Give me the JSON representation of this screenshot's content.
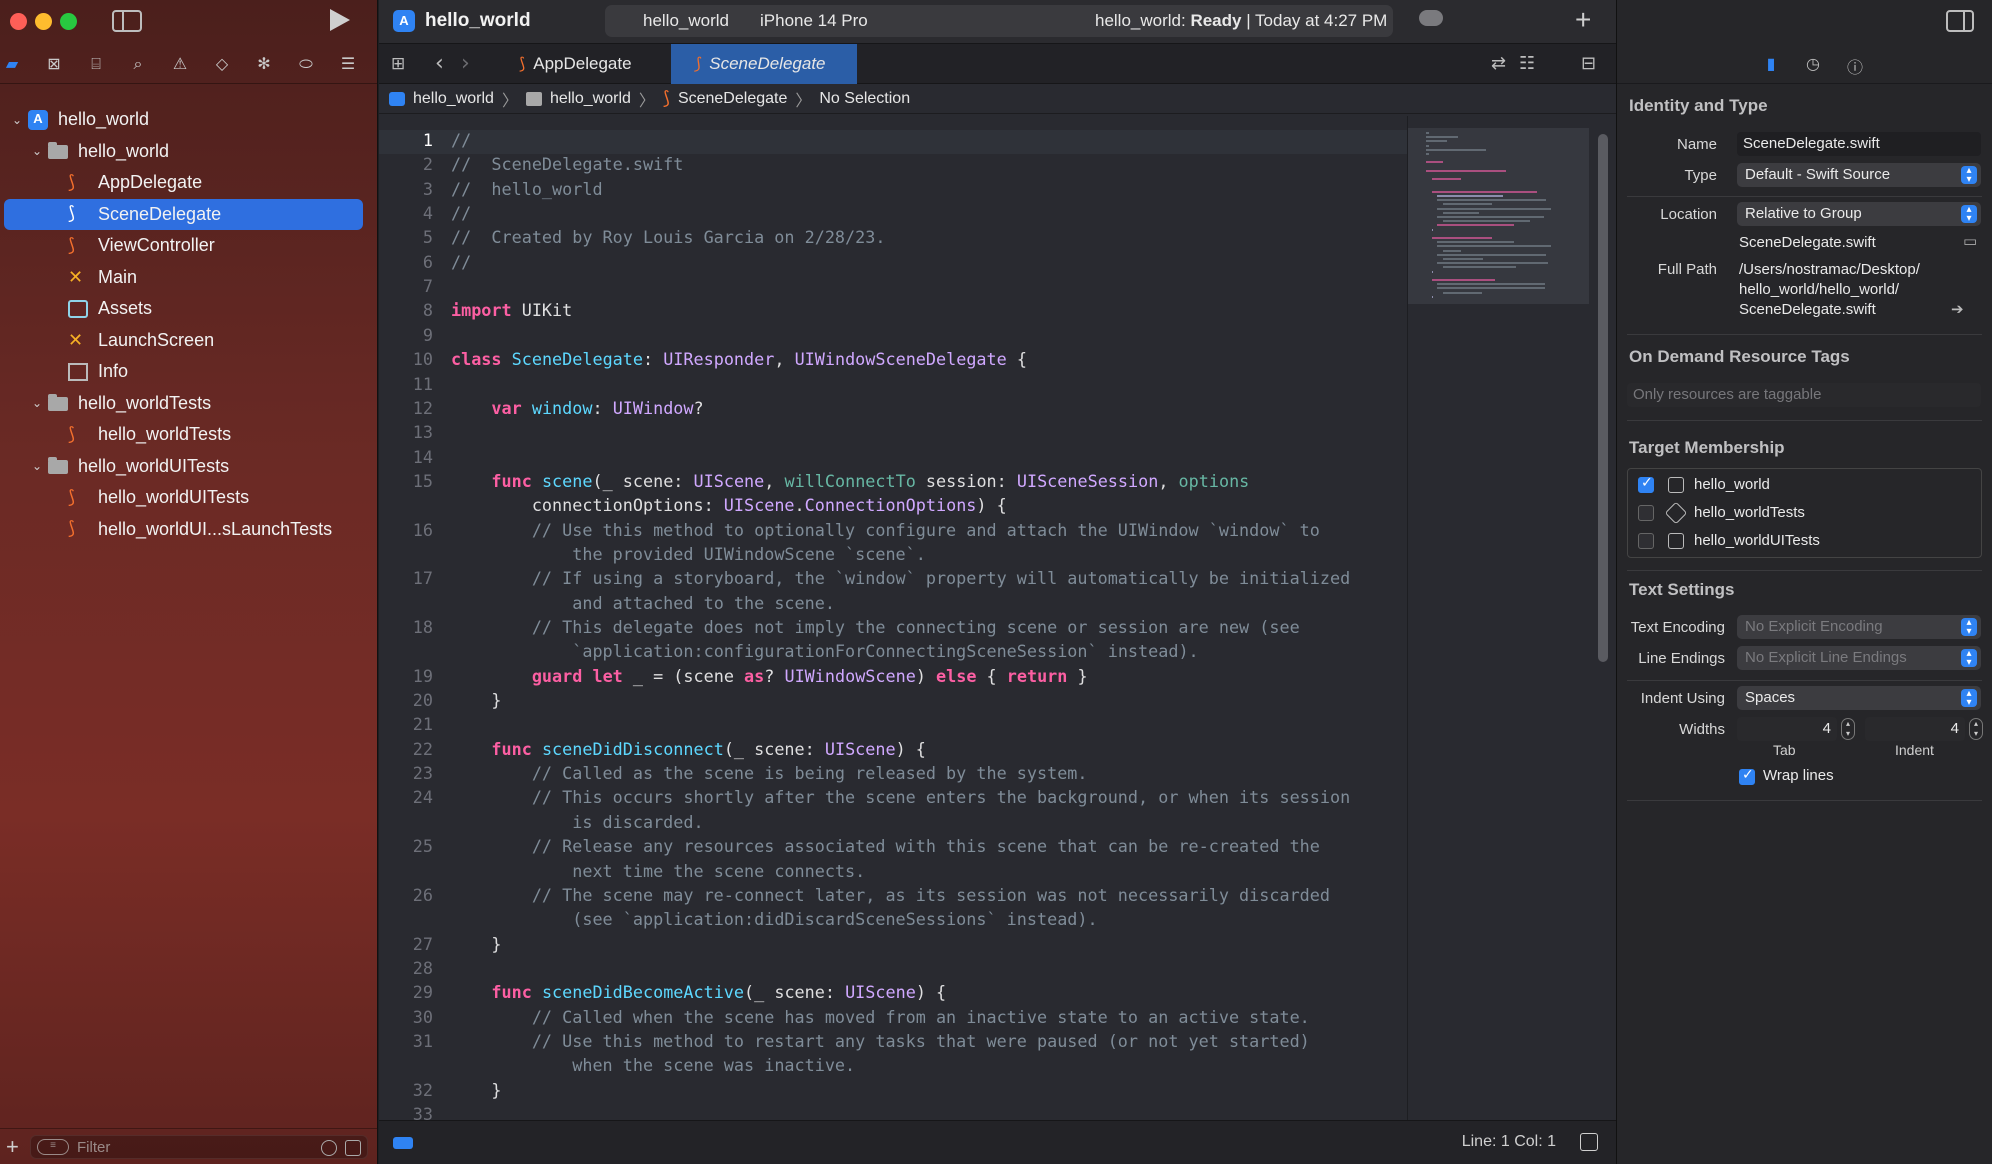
{
  "navigator": {
    "tree": [
      {
        "label": "hello_world",
        "level": 0,
        "icon": "project-icon",
        "expanded": true
      },
      {
        "label": "hello_world",
        "level": 1,
        "icon": "folder-icon",
        "expanded": true
      },
      {
        "label": "AppDelegate",
        "level": 2,
        "icon": "swift-file-icon"
      },
      {
        "label": "SceneDelegate",
        "level": 2,
        "icon": "swift-file-icon",
        "selected": true
      },
      {
        "label": "ViewController",
        "level": 2,
        "icon": "swift-file-icon"
      },
      {
        "label": "Main",
        "level": 2,
        "icon": "storyboard-icon"
      },
      {
        "label": "Assets",
        "level": 2,
        "icon": "asset-catalog-icon"
      },
      {
        "label": "LaunchScreen",
        "level": 2,
        "icon": "storyboard-icon"
      },
      {
        "label": "Info",
        "level": 2,
        "icon": "plist-icon"
      },
      {
        "label": "hello_worldTests",
        "level": 1,
        "icon": "folder-icon",
        "expanded": true
      },
      {
        "label": "hello_worldTests",
        "level": 2,
        "icon": "swift-file-icon"
      },
      {
        "label": "hello_worldUITests",
        "level": 1,
        "icon": "folder-icon",
        "expanded": true
      },
      {
        "label": "hello_worldUITests",
        "level": 2,
        "icon": "swift-file-icon"
      },
      {
        "label": "hello_worldUI...sLaunchTests",
        "level": 2,
        "icon": "swift-file-icon"
      }
    ],
    "filter_placeholder": "Filter"
  },
  "toolbar": {
    "project_title": "hello_world",
    "scheme": "hello_world",
    "device": "iPhone 14 Pro",
    "status_prefix": "hello_world: ",
    "status_state": "Ready",
    "status_suffix": " | Today at 4:27 PM"
  },
  "tabs": [
    {
      "label": "AppDelegate",
      "active": false
    },
    {
      "label": "SceneDelegate",
      "active": true
    }
  ],
  "jumpbar": [
    "hello_world",
    "hello_world",
    "SceneDelegate",
    "No Selection"
  ],
  "code": {
    "current_line": 1,
    "lines": [
      {
        "n": "1",
        "html": "<span class='cmt'>//</span>"
      },
      {
        "n": "2",
        "html": "<span class='cmt'>//  SceneDelegate.swift</span>"
      },
      {
        "n": "3",
        "html": "<span class='cmt'>//  hello_world</span>"
      },
      {
        "n": "4",
        "html": "<span class='cmt'>//</span>"
      },
      {
        "n": "5",
        "html": "<span class='cmt'>//  Created by Roy Louis Garcia on 2/28/23.</span>"
      },
      {
        "n": "6",
        "html": "<span class='cmt'>//</span>"
      },
      {
        "n": "7",
        "html": ""
      },
      {
        "n": "8",
        "html": "<span class='kw'>import</span> UIKit"
      },
      {
        "n": "9",
        "html": ""
      },
      {
        "n": "10",
        "html": "<span class='kw'>class</span> <span class='cls'>SceneDelegate</span>: <span class='ty'>UIResponder</span>, <span class='ty'>UIWindowSceneDelegate</span> {"
      },
      {
        "n": "11",
        "html": ""
      },
      {
        "n": "12",
        "html": "    <span class='kw'>var</span> <span class='cls'>window</span>: <span class='ty'>UIWindow</span>?"
      },
      {
        "n": "13",
        "html": ""
      },
      {
        "n": "14",
        "html": ""
      },
      {
        "n": "15",
        "html": "    <span class='kw'>func</span> <span class='cls'>scene</span>(_ scene: <span class='ty'>UIScene</span>, <span class='fn'>willConnectTo</span> session: <span class='ty'>UISceneSession</span>, <span class='fn'>options</span>"
      },
      {
        "n": "",
        "html": "        connectionOptions: <span class='ty'>UIScene</span>.<span class='ty'>ConnectionOptions</span>) {"
      },
      {
        "n": "16",
        "html": "        <span class='cmt'>// Use this method to optionally configure and attach the UIWindow `window` to</span>"
      },
      {
        "n": "",
        "html": "            <span class='cmt'>the provided UIWindowScene `scene`.</span>"
      },
      {
        "n": "17",
        "html": "        <span class='cmt'>// If using a storyboard, the `window` property will automatically be initialized</span>"
      },
      {
        "n": "",
        "html": "            <span class='cmt'>and attached to the scene.</span>"
      },
      {
        "n": "18",
        "html": "        <span class='cmt'>// This delegate does not imply the connecting scene or session are new (see</span>"
      },
      {
        "n": "",
        "html": "            <span class='cmt'>`application:configurationForConnectingSceneSession` instead).</span>"
      },
      {
        "n": "19",
        "html": "        <span class='kw'>guard</span> <span class='kw'>let</span> _ = (scene <span class='kw'>as</span>? <span class='ty'>UIWindowScene</span>) <span class='kw'>else</span> { <span class='kw'>return</span> }"
      },
      {
        "n": "20",
        "html": "    }"
      },
      {
        "n": "21",
        "html": ""
      },
      {
        "n": "22",
        "html": "    <span class='kw'>func</span> <span class='cls'>sceneDidDisconnect</span>(_ scene: <span class='ty'>UIScene</span>) {"
      },
      {
        "n": "23",
        "html": "        <span class='cmt'>// Called as the scene is being released by the system.</span>"
      },
      {
        "n": "24",
        "html": "        <span class='cmt'>// This occurs shortly after the scene enters the background, or when its session</span>"
      },
      {
        "n": "",
        "html": "            <span class='cmt'>is discarded.</span>"
      },
      {
        "n": "25",
        "html": "        <span class='cmt'>// Release any resources associated with this scene that can be re-created the</span>"
      },
      {
        "n": "",
        "html": "            <span class='cmt'>next time the scene connects.</span>"
      },
      {
        "n": "26",
        "html": "        <span class='cmt'>// The scene may re-connect later, as its session was not necessarily discarded</span>"
      },
      {
        "n": "",
        "html": "            <span class='cmt'>(see `application:didDiscardSceneSessions` instead).</span>"
      },
      {
        "n": "27",
        "html": "    }"
      },
      {
        "n": "28",
        "html": ""
      },
      {
        "n": "29",
        "html": "    <span class='kw'>func</span> <span class='cls'>sceneDidBecomeActive</span>(_ scene: <span class='ty'>UIScene</span>) {"
      },
      {
        "n": "30",
        "html": "        <span class='cmt'>// Called when the scene has moved from an inactive state to an active state.</span>"
      },
      {
        "n": "31",
        "html": "        <span class='cmt'>// Use this method to restart any tasks that were paused (or not yet started)</span>"
      },
      {
        "n": "",
        "html": "            <span class='cmt'>when the scene was inactive.</span>"
      },
      {
        "n": "32",
        "html": "    }"
      },
      {
        "n": "33",
        "html": ""
      }
    ]
  },
  "statusbar": {
    "position": "Line: 1  Col: 1"
  },
  "inspector": {
    "identity_title": "Identity and Type",
    "name_label": "Name",
    "name_value": "SceneDelegate.swift",
    "type_label": "Type",
    "type_value": "Default - Swift Source",
    "location_label": "Location",
    "location_value": "Relative to Group",
    "location_file": "SceneDelegate.swift",
    "fullpath_label": "Full Path",
    "fullpath_1": "/Users/nostramac/Desktop/",
    "fullpath_2": "hello_world/hello_world/",
    "fullpath_3": "SceneDelegate.swift",
    "odr_title": "On Demand Resource Tags",
    "odr_placeholder": "Only resources are taggable",
    "tm_title": "Target Membership",
    "targets": [
      {
        "label": "hello_world",
        "checked": true
      },
      {
        "label": "hello_worldTests",
        "checked": false
      },
      {
        "label": "hello_worldUITests",
        "checked": false
      }
    ],
    "text_title": "Text Settings",
    "encoding_label": "Text Encoding",
    "encoding_value": "No Explicit Encoding",
    "endings_label": "Line Endings",
    "endings_value": "No Explicit Line Endings",
    "indent_label": "Indent Using",
    "indent_value": "Spaces",
    "widths_label": "Widths",
    "tab_width": "4",
    "indent_width": "4",
    "tab_label": "Tab",
    "indent_label2": "Indent",
    "wrap_label": "Wrap lines"
  },
  "colors": {
    "accent": "#2f83f3",
    "keyword": "#fc5fa3",
    "type": "#d0a8ff",
    "comment": "#7f8c98",
    "swift": "#f36f2d"
  }
}
